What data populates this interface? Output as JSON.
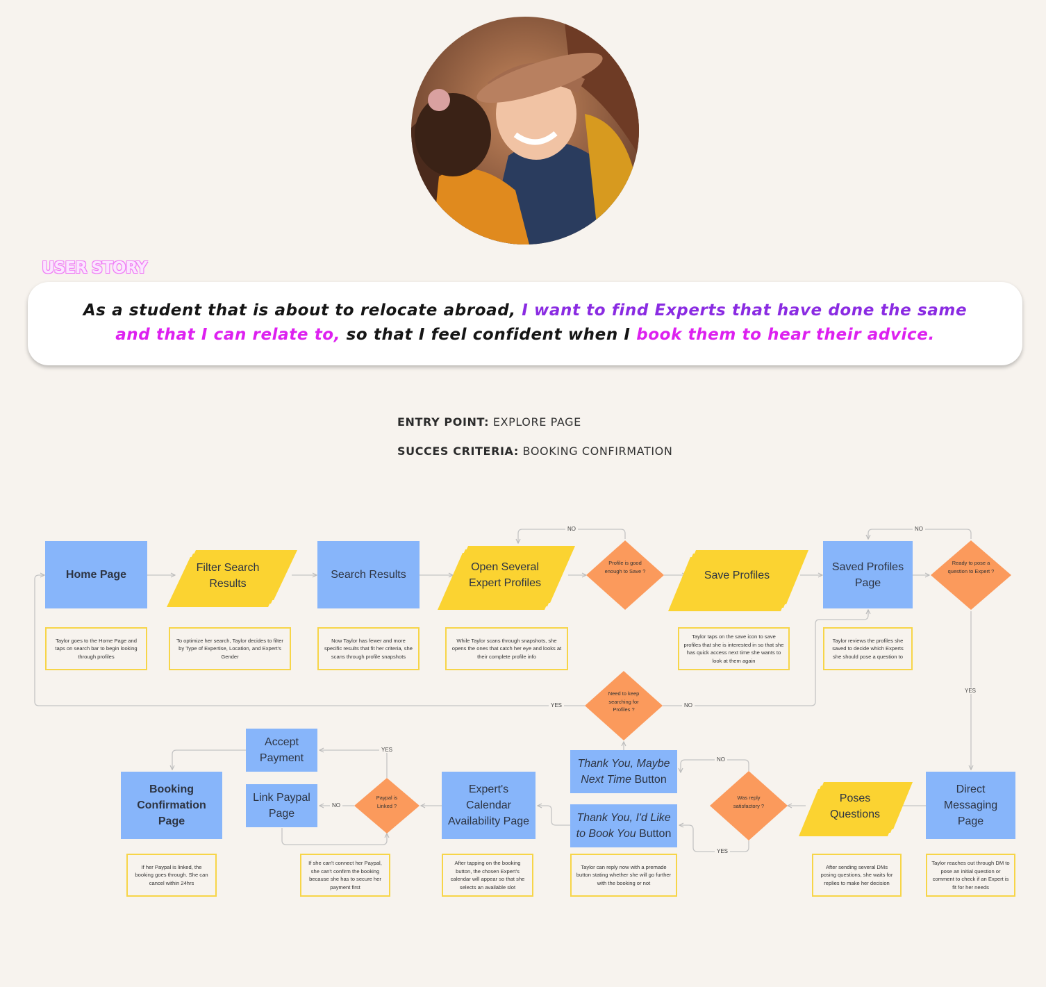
{
  "user_story": {
    "label": "USER STORY",
    "line1_a": "As a student that is about to relocate abroad, ",
    "line1_b": "I want to find Experts that have done the same",
    "line2_a": "and that I can relate to,",
    "line2_b": " so that I feel confident when I ",
    "line2_c": "book them to hear their advice."
  },
  "entry_point": {
    "label": "ENTRY POINT:",
    "value": "EXPLORE PAGE"
  },
  "success_criteria": {
    "label": "SUCCES CRITERIA:",
    "value": "BOOKING CONFIRMATION"
  },
  "colors": {
    "blue": "#87b5fa",
    "yellow": "#fbd331",
    "orange": "#fb9a5c",
    "note_border": "#f7d548",
    "purple": "#8a2be2",
    "magenta": "#dd20f0"
  },
  "flow": {
    "home_page": "Home Page",
    "filter_search": "Filter Search Results",
    "search_results": "Search Results",
    "open_profiles": "Open Several Expert Profiles",
    "profile_good": "Profile is good enough to Save ?",
    "save_profiles": "Save Profiles",
    "saved_profiles_page": "Saved Profiles Page",
    "ready_pose": "Ready to pose a question to Expert ?",
    "need_keep": "Need to keep searching for Profiles ?",
    "direct_messaging": "Direct Messaging Page",
    "poses_questions": "Poses Questions",
    "reply_satisfactory": "Was reply satisfactory ?",
    "thank_maybe_italic": "Thank You, Maybe Next Time",
    "thank_maybe_plain": "Button",
    "thank_book_italic": "Thank You, I'd Like to Book You",
    "thank_book_plain": "Button",
    "calendar_page": "Expert's Calendar Availability Page",
    "paypal_linked": "Paypal is Linked ?",
    "accept_payment": "Accept Payment",
    "link_paypal": "Link Paypal Page",
    "booking_confirmation": "Booking Confirmation Page"
  },
  "notes": {
    "home": "Taylor goes to the Home Page and taps on search bar to begin looking through profiles",
    "filter": "To optimize her search, Taylor decides to filter by Type of Expertise, Location, and Expert's Gender",
    "search": "Now Taylor has fewer and more specific results that fit her criteria, she scans through profile snapshots",
    "open": "While Taylor scans through snapshots, she opens the ones that catch her eye and looks at their complete profile info",
    "save": "Taylor taps on the save icon to save profiles that she is interested in so that she has quick access next time she wants to look at them again",
    "saved": "Taylor reviews the profiles she saved to decide which Experts she should pose a question to",
    "dm": "Taylor reaches out through DM to pose an initial question or comment to check if an Expert is fit for her needs",
    "poses": "After sending several DMs posing questions, she waits for replies to make her decision",
    "thank": "Taylor can reply now with a premade button stating whether she will go further with the booking or not",
    "calendar": "After tapping on the booking button, the chosen Expert's calendar will appear so that she selects an available slot",
    "paypal": "If she can't connect her Paypal, she can't confirm the booking because she has to secure her payment first",
    "booking": "If her Paypal is linked, the booking goes through. She can cancel within 24hrs"
  },
  "edge_labels": {
    "no": "NO",
    "yes": "YES"
  }
}
